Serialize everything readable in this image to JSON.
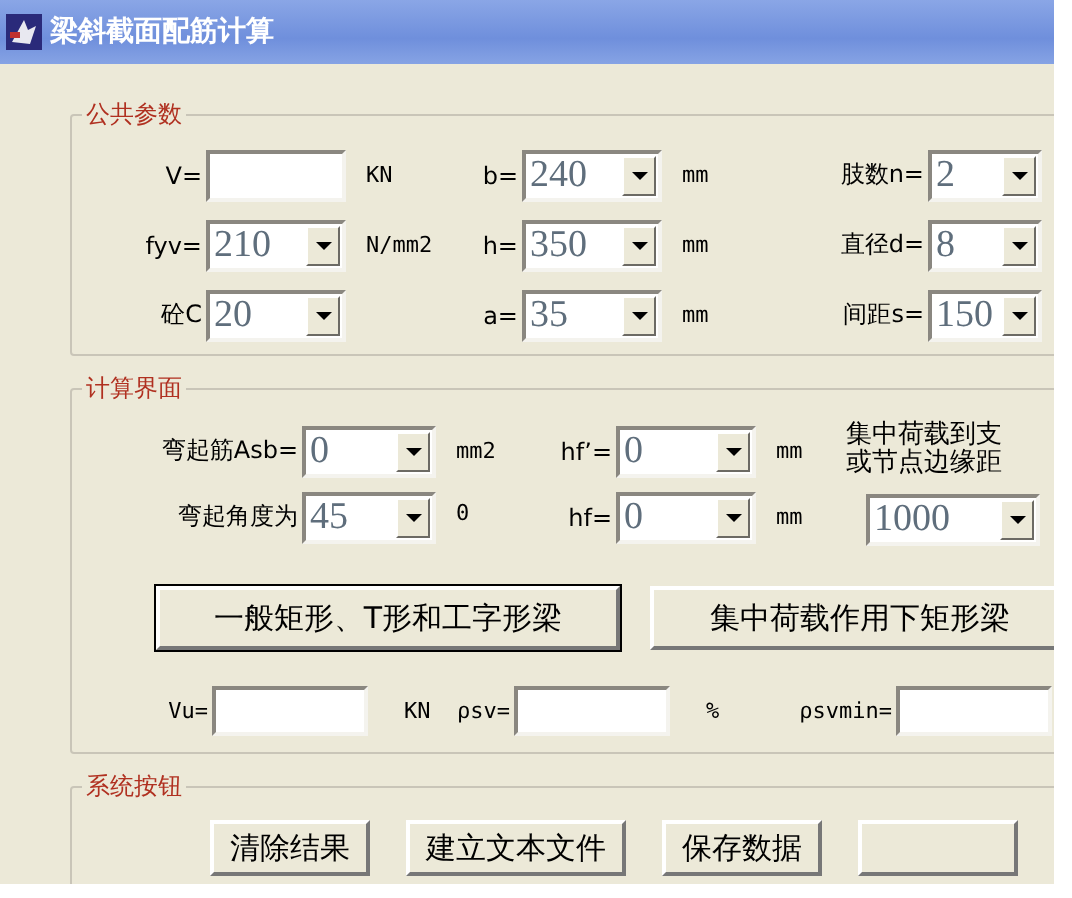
{
  "window": {
    "title": "梁斜截面配筋计算"
  },
  "groups": [
    {
      "kind": "params",
      "title": "公共参数",
      "rows": [
        [
          {
            "label": "V=",
            "control": {
              "kind": "field"
            },
            "unit": "KN"
          },
          {
            "label": "b=",
            "control": {
              "kind": "combo",
              "value": "240"
            },
            "unit": "mm"
          },
          {
            "label": "肢数n=",
            "control": {
              "kind": "combo",
              "value": "2"
            }
          }
        ],
        [
          {
            "label": "fyv=",
            "control": {
              "kind": "combo",
              "value": "210"
            },
            "unit": "N/mm2"
          },
          {
            "label": "h=",
            "control": {
              "kind": "combo",
              "value": "350"
            },
            "unit": "mm"
          },
          {
            "label": "直径d=",
            "control": {
              "kind": "combo",
              "value": "8"
            }
          }
        ],
        [
          {
            "label": "砼C",
            "control": {
              "kind": "combo",
              "value": "20"
            }
          },
          {
            "label": "a=",
            "control": {
              "kind": "combo",
              "value": "35"
            },
            "unit": "mm"
          },
          {
            "label": "间距s=",
            "control": {
              "kind": "combo",
              "value": "150"
            }
          }
        ]
      ]
    },
    {
      "kind": "calc",
      "title": "计算界面",
      "rows": [
        [
          {
            "label": "弯起筋Asb=",
            "control": {
              "kind": "combo",
              "value": "0"
            },
            "unit": "mm2"
          },
          {
            "label": "hf’=",
            "control": {
              "kind": "combo",
              "value": "0"
            },
            "unit": "mm"
          }
        ],
        [
          {
            "label": "弯起角度为",
            "control": {
              "kind": "combo",
              "value": "45"
            },
            "unit": "$^{0}$"
          },
          {
            "label": "hf=",
            "control": {
              "kind": "combo",
              "value": "0"
            },
            "unit": "mm"
          }
        ]
      ],
      "side": {
        "note": [
          "集中荷载到支",
          "或节点边缘距"
        ],
        "control": {
          "kind": "combo",
          "value": "1000"
        }
      },
      "buttons": [
        {
          "label": "一般矩形、T形和工字形梁",
          "default": true
        },
        {
          "label": "集中荷载作用下矩形梁",
          "default": false
        }
      ],
      "results": [
        {
          "label": "Vu=",
          "control": {
            "kind": "field"
          },
          "unit": "KN"
        },
        {
          "label": "ρsv=",
          "control": {
            "kind": "field"
          },
          "unit": "%"
        },
        {
          "label": "ρsvmin=",
          "control": {
            "kind": "field"
          }
        }
      ]
    },
    {
      "kind": "buttons",
      "title": "系统按钮",
      "buttons": [
        {
          "label": "清除结果",
          "default": false
        },
        {
          "label": "建立文本文件",
          "default": false
        },
        {
          "label": "保存数据",
          "default": false
        },
        {
          "default": false
        }
      ]
    }
  ]
}
